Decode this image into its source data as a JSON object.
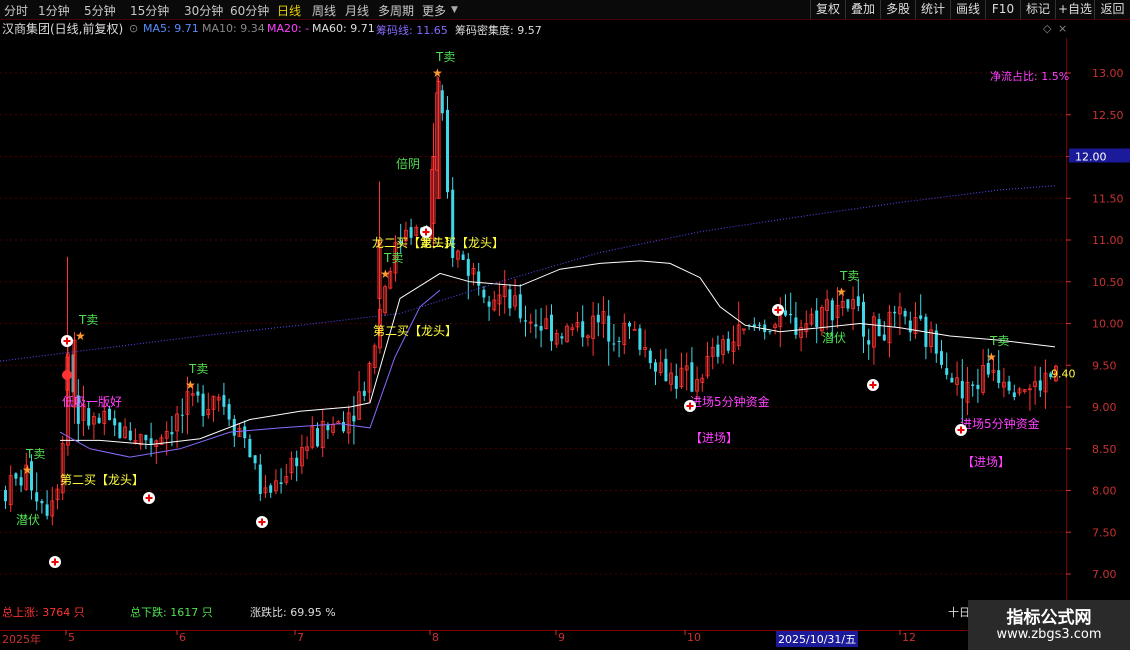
{
  "toolbar": {
    "periods": [
      "分时",
      "1分钟",
      "5分钟",
      "15分钟",
      "30分钟",
      "60分钟",
      "日线",
      "周线",
      "月线",
      "多周期",
      "更多"
    ],
    "active_period": "日线",
    "right_buttons": [
      "复权",
      "叠加",
      "多股",
      "统计",
      "画线",
      "F10",
      "标记",
      "+自选",
      "返回"
    ]
  },
  "info_bar": {
    "stock_title": "汉商集团(日线,前复权)",
    "ma5": "MA5: 9.71",
    "ma10": "MA10: 9.34",
    "ma20": "MA20: -",
    "ma60": "MA60: 9.71",
    "chip_line": "筹码线: 11.65",
    "chip_density": "筹码密集度: 9.57"
  },
  "colors": {
    "up": "#ff3232",
    "down": "#40d8e8",
    "ma60": "#ffffff",
    "ma_purple": "#8a6aff",
    "magenta": "#ff40ff",
    "yellow": "#ffff40",
    "green": "#50e050",
    "grid": "#4a0000"
  },
  "price_axis": {
    "ticks": [
      "13.00",
      "12.50",
      "12.00",
      "11.50",
      "11.00",
      "10.50",
      "10.00",
      "9.50",
      "9.00",
      "8.50",
      "8.00",
      "7.50",
      "7.00"
    ],
    "highlight": "12.00",
    "current_price": "9.40"
  },
  "chart_data": {
    "type": "candlestick",
    "ylim": [
      6.8,
      13.35
    ],
    "current_price": 9.4,
    "net_flow_ratio": "净流占比: 1.5%",
    "annotations": [
      {
        "text": "T卖",
        "kind": "t-sell"
      },
      {
        "text": "潜伏",
        "kind": "lurk"
      },
      {
        "text": "第二买【龙头】",
        "kind": "buy"
      },
      {
        "text": "倍阴",
        "kind": "double-yin"
      },
      {
        "text": "进场5分钟资金",
        "kind": "entry-fund"
      },
      {
        "text": "【进场】",
        "kind": "entry"
      },
      {
        "text": "低吸一版好",
        "kind": "low-buy"
      },
      {
        "text": "龙二买【龙头】",
        "kind": "dragon-buy"
      }
    ]
  },
  "date_axis": [
    "2025年",
    "5",
    "6",
    "7",
    "8",
    "9",
    "10",
    "2025/10/31/五",
    "12"
  ],
  "bottom_stats": {
    "total_up": "总上涨: 3764 只",
    "total_down": "总下跌: 1617 只",
    "ratio": "涨跌比: 69.95 %",
    "cursor_label": "十日"
  },
  "watermark": {
    "title": "指标公式网",
    "url": "www.zbgs3.com"
  }
}
